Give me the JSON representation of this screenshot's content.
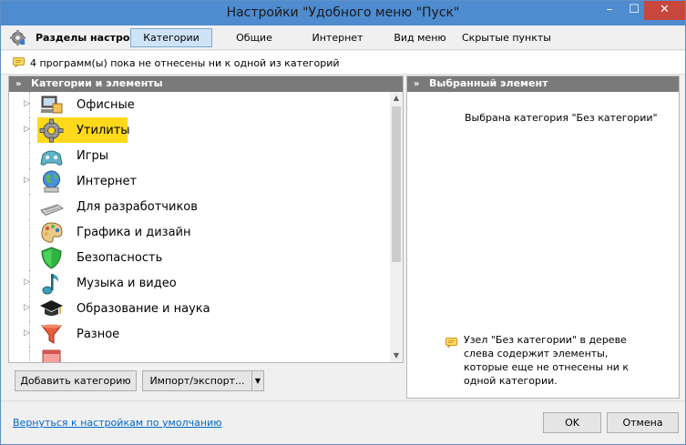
{
  "window": {
    "title": "Настройки \"Удобного меню \"Пуск\"",
    "controls": {
      "minimize": "–",
      "maximize": "☐",
      "close": "✕"
    }
  },
  "toolbar": {
    "sections_label": "Разделы настроек:",
    "tabs": [
      {
        "label": "Категории",
        "active": true
      },
      {
        "label": "Общие",
        "active": false
      },
      {
        "label": "Интернет",
        "active": false
      },
      {
        "label": "Вид меню",
        "active": false
      },
      {
        "label": "Скрытые пункты",
        "active": false
      }
    ]
  },
  "info": {
    "message": "4 программ(ы) пока не отнесены ни к одной из категорий"
  },
  "left_panel": {
    "header": "Категории и элементы",
    "items": [
      {
        "label": "Офисные",
        "icon": "office-icon",
        "expandable": true,
        "selected": false
      },
      {
        "label": "Утилиты",
        "icon": "gear-icon",
        "expandable": true,
        "selected": true
      },
      {
        "label": "Игры",
        "icon": "gamepad-icon",
        "expandable": false,
        "selected": false
      },
      {
        "label": "Интернет",
        "icon": "globe-icon",
        "expandable": true,
        "selected": false
      },
      {
        "label": "Для разработчиков",
        "icon": "keyboard-icon",
        "expandable": false,
        "selected": false
      },
      {
        "label": "Графика и дизайн",
        "icon": "palette-icon",
        "expandable": false,
        "selected": false
      },
      {
        "label": "Безопасность",
        "icon": "shield-icon",
        "expandable": false,
        "selected": false
      },
      {
        "label": "Музыка и видео",
        "icon": "music-icon",
        "expandable": true,
        "selected": false
      },
      {
        "label": "Образование и наука",
        "icon": "graduation-cap-icon",
        "expandable": true,
        "selected": false
      },
      {
        "label": "Разное",
        "icon": "funnel-icon",
        "expandable": true,
        "selected": false
      }
    ],
    "buttons": {
      "add_category": "Добавить категорию",
      "import_export": "Импорт/экспорт..."
    }
  },
  "right_panel": {
    "header": "Выбранный элемент",
    "selected_text": "Выбрана категория \"Без категории\"",
    "hint": "Узел \"Без категории\" в дереве слева содержит элементы, которые еще не отнесены ни к одной категории."
  },
  "footer": {
    "reset_link": "Вернуться к настройкам по умолчанию",
    "ok": "OK",
    "cancel": "Отмена"
  },
  "colors": {
    "title_bar": "#4e8bcf",
    "close_button": "#c7473d",
    "panel_header": "#7a7a7a",
    "selection": "#ffd91a",
    "active_tab": "#cfe3f7",
    "link": "#0066cc"
  }
}
